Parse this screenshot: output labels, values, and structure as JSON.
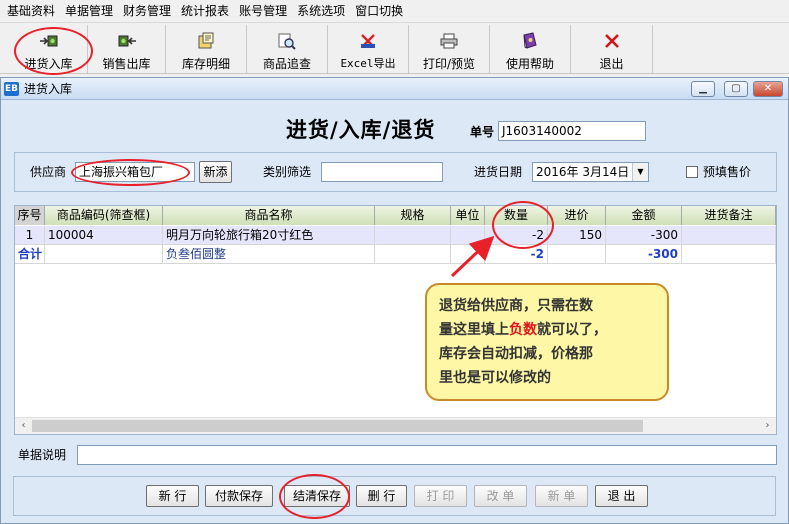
{
  "menu": [
    "基础资料",
    "单据管理",
    "财务管理",
    "统计报表",
    "账号管理",
    "系统选项",
    "窗口切换"
  ],
  "toolbar": [
    {
      "label": "进货入库",
      "icon": "stock-in-icon"
    },
    {
      "label": "销售出库",
      "icon": "stock-out-icon"
    },
    {
      "label": "库存明细",
      "icon": "inventory-icon"
    },
    {
      "label": "商品追查",
      "icon": "product-search-icon"
    },
    {
      "label": "Excel导出",
      "icon": "excel-icon"
    },
    {
      "label": "打印/预览",
      "icon": "printer-icon"
    },
    {
      "label": "使用帮助",
      "icon": "help-book-icon"
    },
    {
      "label": "退出",
      "icon": "exit-x-icon"
    }
  ],
  "window": {
    "title": "进货入库",
    "app_icon": "EB"
  },
  "form": {
    "heading": "进货/入库/退货",
    "doc_no_label": "单号",
    "doc_no": "J1603140002",
    "supplier_label": "供应商",
    "supplier": "上海振兴箱包厂",
    "add_button": "新添",
    "category_label": "类别筛选",
    "category_value": "",
    "date_label": "进货日期",
    "date_value": "2016年 3月14日",
    "prefill_label": "预填售价",
    "prefill_checked": false
  },
  "grid": {
    "headers": [
      "序号",
      "商品编码(筛查框)",
      "商品名称",
      "规格",
      "单位",
      "数量",
      "进价",
      "金额",
      "进货备注"
    ],
    "rows": [
      {
        "seq": "1",
        "code": "100004",
        "name": "明月万向轮旅行箱20寸红色",
        "spec": "",
        "unit": "",
        "qty": "-2",
        "price": "150",
        "amount": "-300",
        "note": ""
      }
    ],
    "total": {
      "label": "合计",
      "amount_text": "负叁佰圆整",
      "qty": "-2",
      "amount": "-300"
    }
  },
  "annotation": {
    "line1": "退货给供应商，只需在数",
    "line2_a": "量这里填上",
    "line2_red": "负数",
    "line2_b": "就可以了，",
    "line3": "库存会自动扣减，价格那",
    "line4": "里也是可以修改的"
  },
  "memo_label": "单据说明",
  "memo_value": "",
  "buttons": [
    {
      "label": "新 行",
      "enabled": true
    },
    {
      "label": "付款保存",
      "enabled": true
    },
    {
      "label": "结清保存",
      "enabled": true
    },
    {
      "label": "删 行",
      "enabled": true
    },
    {
      "label": "打 印",
      "enabled": false
    },
    {
      "label": "改 单",
      "enabled": false
    },
    {
      "label": "新 单",
      "enabled": false
    },
    {
      "label": "退 出",
      "enabled": true
    }
  ],
  "colors": {
    "highlight_ring": "#e8202a",
    "callout_bg": "#fdf7a6",
    "total_text": "#1d3ec4"
  }
}
